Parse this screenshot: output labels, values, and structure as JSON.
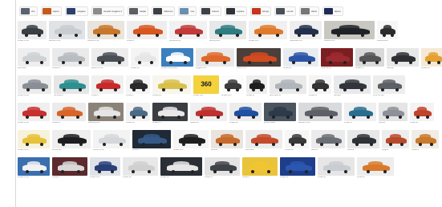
{
  "filter_chips": [
    {
      "label": "clio",
      "color": "#5a6470"
    },
    {
      "label": "captur",
      "color": "#c45a1c"
    },
    {
      "label": "megane",
      "color": "#2a3f6b"
    },
    {
      "label": "renault megane 4",
      "color": "#8c8c8c"
    },
    {
      "label": "kadjar",
      "color": "#5d5d63"
    },
    {
      "label": "talisman",
      "color": "#3b3f46"
    },
    {
      "label": "zoe",
      "color": "#6b8fb2"
    },
    {
      "label": "koleos",
      "color": "#3d4148"
    },
    {
      "label": "espace",
      "color": "#2f3238"
    },
    {
      "label": "twingo",
      "color": "#c7351c"
    },
    {
      "label": "scenic",
      "color": "#4a4f57"
    },
    {
      "label": "dacia",
      "color": "#777"
    },
    {
      "label": "alpine",
      "color": "#1e2c55"
    }
  ],
  "rows": [
    {
      "tiles": [
        {
          "w": 36,
          "bg": "#ececec",
          "car": "#3a3f45"
        },
        {
          "w": 45,
          "bg": "#dfe3e6",
          "car": "#c9ccd0"
        },
        {
          "w": 46,
          "bg": "#e9e4dc",
          "car": "#c8782a"
        },
        {
          "w": 50,
          "bg": "#ededed",
          "car": "#d8571f"
        },
        {
          "w": 47,
          "bg": "#f1f1f1",
          "car": "#c23a3a"
        },
        {
          "w": 46,
          "bg": "#e6e8e9",
          "car": "#2e7d80"
        },
        {
          "w": 48,
          "bg": "#f0f0f0",
          "car": "#e07a2a"
        },
        {
          "w": 40,
          "bg": "#eeeeee",
          "car": "#23304d"
        },
        {
          "w": 63,
          "bg": "#c9c7c2",
          "car": "#1f2226"
        },
        {
          "w": 26,
          "bg": "#f6f6f6",
          "car": "#2c2c2c"
        }
      ],
      "captions": [
        "renault.co.uk",
        "autocar.co.uk",
        "carwow.co.uk",
        "renault.fr",
        "wikipedia.org",
        "autoexpress",
        "renault.com",
        "caradisiac.com",
        "whatcar.com",
        "tradecarview"
      ]
    },
    {
      "tiles": [
        {
          "w": 40,
          "bg": "#eeeeee",
          "car": "#cfd2d5"
        },
        {
          "w": 46,
          "bg": "#eaeaea",
          "car": "#b8bdc2"
        },
        {
          "w": 46,
          "bg": "#ececec",
          "car": "#4a4e55"
        },
        {
          "w": 35,
          "bg": "#f4f4f4",
          "car": "#e6e6e6"
        },
        {
          "w": 40,
          "bg": "#3b7fbf",
          "car": "#ffffff"
        },
        {
          "w": 48,
          "bg": "#e8e8e8",
          "car": "#e0682a"
        },
        {
          "w": 55,
          "bg": "#4a3f3a",
          "car": "#d24a1e"
        },
        {
          "w": 44,
          "bg": "#e9ecef",
          "car": "#2b55a8"
        },
        {
          "w": 40,
          "bg": "#7a1e22",
          "car": "#9c2a2e"
        },
        {
          "w": 36,
          "bg": "#d9d9d9",
          "car": "#555"
        },
        {
          "w": 40,
          "bg": "#e7e7e7",
          "car": "#2e2f33"
        },
        {
          "w": 30,
          "bg": "#f3e9d6",
          "car": "#e4a030"
        }
      ],
      "captions": [
        "autotrader",
        "renault.ie",
        "parkers.co.uk",
        "renault.be",
        "renault-configurator",
        "topgear.com",
        "motor1.com",
        "renault.de",
        "caranddriver",
        "renault.nl",
        "carbuyer",
        "renault.es"
      ]
    },
    {
      "tiles": [
        {
          "w": 42,
          "bg": "#ececec",
          "car": "#8a8f96"
        },
        {
          "w": 44,
          "bg": "#e6e6e6",
          "car": "#2d8f8f"
        },
        {
          "w": 40,
          "bg": "#f0f0f0",
          "car": "#c82a2a"
        },
        {
          "w": 30,
          "bg": "#f5f5f5",
          "car": "#2a2a2a"
        },
        {
          "w": 48,
          "bg": "#f7f5ee",
          "car": "#d9c04a"
        },
        {
          "w": 32,
          "bg": "#f4d23c",
          "car": "#f4d23c",
          "badge": "360"
        },
        {
          "w": 28,
          "bg": "#fbfbfb",
          "car": "#3c3c3c"
        },
        {
          "w": 26,
          "bg": "#eeeeee",
          "car": "#1d1d1d"
        },
        {
          "w": 46,
          "bg": "#eaeaea",
          "car": "#b0b5bb"
        },
        {
          "w": 28,
          "bg": "#f4f4f4",
          "car": "#333"
        },
        {
          "w": 46,
          "bg": "#e7e9eb",
          "car": "#31353b"
        },
        {
          "w": 40,
          "bg": "#ededed",
          "car": "#5b5f66"
        }
      ],
      "captions": [
        "renault.co.uk",
        "honestjohn",
        "renault.fr",
        "renault.it",
        "renault360",
        "renault 360",
        "renault.com",
        "renault.pt",
        "auto-data.net",
        "renault.pl",
        "carsales",
        "drive.com.au"
      ]
    },
    {
      "tiles": [
        {
          "w": 40,
          "bg": "#efefef",
          "car": "#c92f2f"
        },
        {
          "w": 42,
          "bg": "#ebebeb",
          "car": "#d9642a"
        },
        {
          "w": 44,
          "bg": "#8c8378",
          "car": "#e5e5e5"
        },
        {
          "w": 30,
          "bg": "#f2f2f2",
          "car": "#4b6a86"
        },
        {
          "w": 44,
          "bg": "#3a3d42",
          "car": "#e8e8e8"
        },
        {
          "w": 46,
          "bg": "#efefef",
          "car": "#c03030"
        },
        {
          "w": 40,
          "bg": "#ececec",
          "car": "#1e4fa3"
        },
        {
          "w": 40,
          "bg": "#4a5560",
          "car": "#2c3a4a"
        },
        {
          "w": 54,
          "bg": "#d8dadc",
          "car": "#5d6167"
        },
        {
          "w": 40,
          "bg": "#efefef",
          "car": "#2a6e8f"
        },
        {
          "w": 36,
          "bg": "#e5e5e5",
          "car": "#8e9197"
        },
        {
          "w": 30,
          "bg": "#f3f3f3",
          "car": "#c2432a"
        }
      ],
      "captions": [
        "renault.co.uk",
        "renault.ie",
        "autoblog.com",
        "renault.be",
        "renault.ch",
        "newsroom",
        "renault.de",
        "group.renault",
        "autocar.co.uk",
        "renault.nl",
        "carwow",
        "renault.at"
      ]
    },
    {
      "tiles": [
        {
          "w": 40,
          "bg": "#f7f2dc",
          "car": "#e8c23a"
        },
        {
          "w": 48,
          "bg": "#eeeeee",
          "car": "#1d1d1f"
        },
        {
          "w": 46,
          "bg": "#f3f3f3",
          "car": "#d5d7da"
        },
        {
          "w": 48,
          "bg": "#1f2a36",
          "car": "#355a8a"
        },
        {
          "w": 44,
          "bg": "#f5f5f5",
          "car": "#1e1e1e"
        },
        {
          "w": 40,
          "bg": "#e9e4dd",
          "car": "#c86b2a"
        },
        {
          "w": 46,
          "bg": "#ececec",
          "car": "#c44a2a"
        },
        {
          "w": 30,
          "bg": "#f6f6f6",
          "car": "#3a3a3a"
        },
        {
          "w": 42,
          "bg": "#ebebeb",
          "car": "#6b7076"
        },
        {
          "w": 40,
          "bg": "#e8e8e8",
          "car": "#2f3338"
        },
        {
          "w": 34,
          "bg": "#ededed",
          "car": "#b84a2a"
        },
        {
          "w": 34,
          "bg": "#f0ece6",
          "car": "#c97a2c"
        }
      ],
      "captions": [
        "renault.co.uk",
        "arnoldclark",
        "motors.co.uk",
        "renault.fr",
        "renault.com",
        "carwow",
        "autotrader",
        "renault.es",
        "parkers",
        "whatcar",
        "topgear",
        "renault.it"
      ]
    },
    {
      "tiles": [
        {
          "w": 40,
          "bg": "#3a6fb0",
          "car": "#f2f2f2"
        },
        {
          "w": 44,
          "bg": "#5c2a2e",
          "car": "#d8d8d8"
        },
        {
          "w": 38,
          "bg": "#dfe2e6",
          "car": "#2a3f7a"
        },
        {
          "w": 44,
          "bg": "#e8e8e8",
          "car": "#d0d0d0"
        },
        {
          "w": 52,
          "bg": "#2a2e35",
          "car": "#e6e6e6"
        },
        {
          "w": 44,
          "bg": "#e3e3e3",
          "car": "#3f4348"
        },
        {
          "w": 44,
          "bg": "#e9c43a",
          "car": "#f0c531"
        },
        {
          "w": 44,
          "bg": "#1e3e8a",
          "car": "#2b57b0"
        },
        {
          "w": 46,
          "bg": "#e6e6e6",
          "car": "#c9cdd2"
        },
        {
          "w": 46,
          "bg": "#ededed",
          "car": "#d87a2a"
        }
      ],
      "captions": [
        "renault.co.uk",
        "renault.fr",
        "renault.com",
        "renault.de",
        "renault.be",
        "renault.nl",
        "renault.it",
        "renault.es",
        "renault.pt",
        "renault.ie"
      ]
    }
  ]
}
